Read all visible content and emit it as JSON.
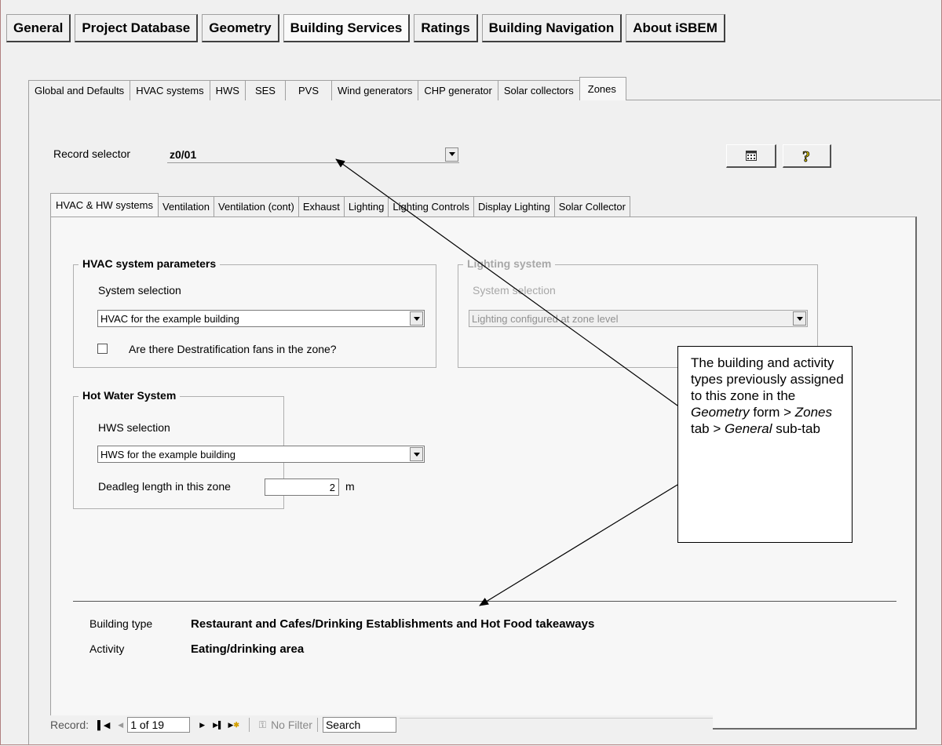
{
  "main_tabs": [
    "General",
    "Project Database",
    "Geometry",
    "Building Services",
    "Ratings",
    "Building Navigation",
    "About iSBEM"
  ],
  "sub_tabs": [
    "Global and Defaults",
    "HVAC systems",
    "HWS",
    "SES",
    "PVS",
    "Wind generators",
    "CHP generator",
    "Solar collectors",
    "Zones"
  ],
  "record_selector": {
    "label": "Record selector",
    "value": "z0/01"
  },
  "inner_tabs": [
    "HVAC & HW systems",
    "Ventilation",
    "Ventilation (cont)",
    "Exhaust",
    "Lighting",
    "Lighting Controls",
    "Display Lighting",
    "Solar Collector"
  ],
  "hvac": {
    "title": "HVAC system parameters",
    "system_label": "System selection",
    "system_value": "HVAC for the example building",
    "destrat_label": "Are there Destratification fans in the zone?"
  },
  "lighting": {
    "title": "Lighting system",
    "system_label": "System selection",
    "system_value": "Lighting configured at zone level"
  },
  "hws": {
    "title": "Hot Water System",
    "selection_label": "HWS selection",
    "selection_value": "HWS for the example building",
    "deadleg_label": "Deadleg length in this zone",
    "deadleg_value": "2",
    "deadleg_unit": "m"
  },
  "building": {
    "type_label": "Building type",
    "type_value": "Restaurant and Cafes/Drinking Establishments and Hot Food takeaways",
    "activity_label": "Activity",
    "activity_value": "Eating/drinking area"
  },
  "callout": {
    "line1": "The building and activity types previously assigned to this zone in the",
    "geometry": "Geometry",
    "line2": " form > ",
    "zones": "Zones",
    "line3": " tab > ",
    "general": "General",
    "line4": " sub-tab"
  },
  "record_nav": {
    "label": "Record:",
    "position": "1 of 19",
    "filter": "No Filter",
    "search": "Search"
  },
  "icons": [
    "calendar-icon",
    "help-icon",
    "first-record-icon",
    "prev-record-icon",
    "next-record-icon",
    "last-record-icon",
    "new-record-icon",
    "filter-icon"
  ]
}
